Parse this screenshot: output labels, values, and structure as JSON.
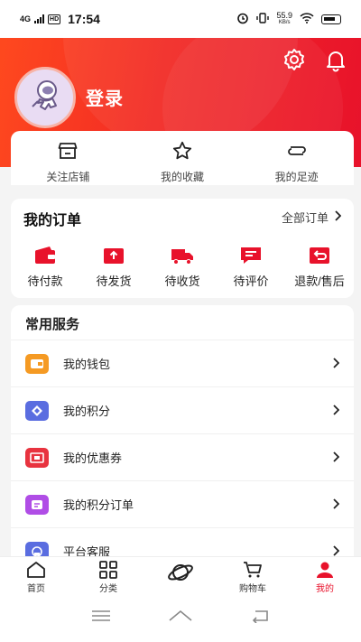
{
  "status_bar": {
    "network": "4G",
    "hd": "HD",
    "time": "17:54",
    "speed_value": "55.9",
    "speed_unit": "KB/s"
  },
  "header": {
    "login_label": "登录",
    "icons": [
      "gear-icon",
      "bell-icon"
    ]
  },
  "quick_links": [
    {
      "label": "关注店铺",
      "icon": "store-icon"
    },
    {
      "label": "我的收藏",
      "icon": "star-icon"
    },
    {
      "label": "我的足迹",
      "icon": "footprint-icon"
    }
  ],
  "orders": {
    "title": "我的订单",
    "all_label": "全部订单",
    "items": [
      {
        "label": "待付款",
        "icon": "wallet-icon"
      },
      {
        "label": "待发货",
        "icon": "box-icon"
      },
      {
        "label": "待收货",
        "icon": "truck-icon"
      },
      {
        "label": "待评价",
        "icon": "comment-icon"
      },
      {
        "label": "退款/售后",
        "icon": "refund-icon"
      }
    ]
  },
  "services": {
    "title": "常用服务",
    "items": [
      {
        "label": "我的钱包",
        "icon": "wallet-icon",
        "color": "#f59a23"
      },
      {
        "label": "我的积分",
        "icon": "points-icon",
        "color": "#5a6de0"
      },
      {
        "label": "我的优惠券",
        "icon": "coupon-icon",
        "color": "#e8333f"
      },
      {
        "label": "我的积分订单",
        "icon": "points-order-icon",
        "color": "#b04de6"
      },
      {
        "label": "平台客服",
        "icon": "customer-service-icon",
        "color": "#5a6de0"
      }
    ]
  },
  "tabbar": [
    {
      "label": "首页",
      "icon": "home-icon"
    },
    {
      "label": "分类",
      "icon": "grid-icon"
    },
    {
      "label": "",
      "icon": "planet-icon"
    },
    {
      "label": "购物车",
      "icon": "cart-icon"
    },
    {
      "label": "我的",
      "icon": "profile-icon",
      "active": true
    }
  ],
  "colors": {
    "brand_red": "#e8122b",
    "brand_orange": "#ff4a1e"
  }
}
